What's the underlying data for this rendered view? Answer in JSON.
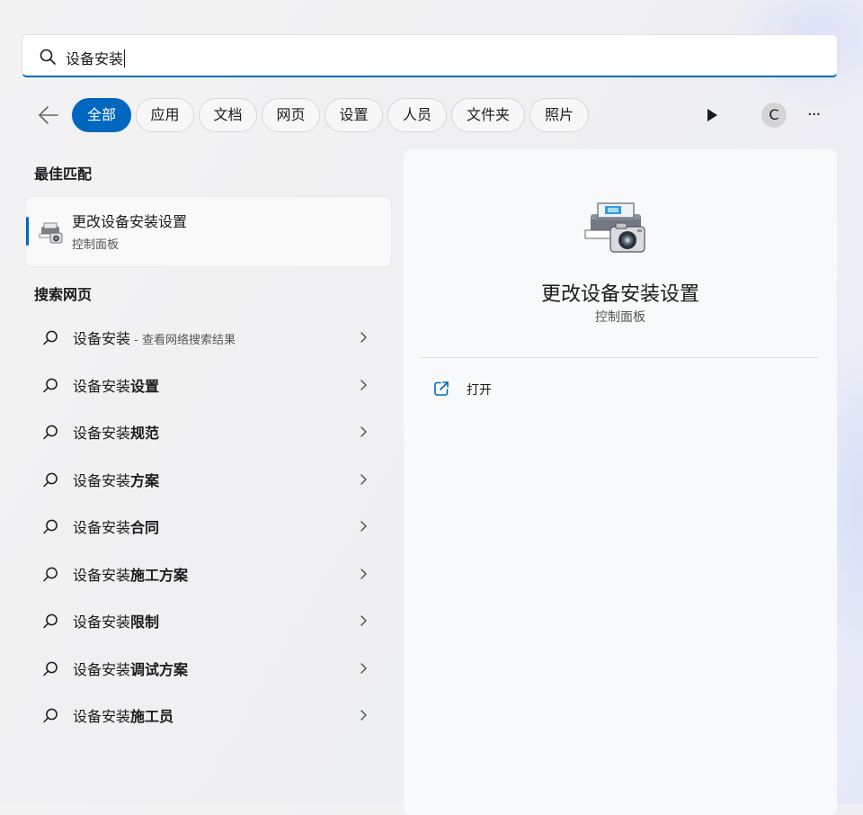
{
  "search": {
    "query": "设备安装"
  },
  "filters": [
    {
      "label": "全部",
      "active": true
    },
    {
      "label": "应用"
    },
    {
      "label": "文档"
    },
    {
      "label": "网页"
    },
    {
      "label": "设置"
    },
    {
      "label": "人员"
    },
    {
      "label": "文件夹"
    },
    {
      "label": "照片"
    }
  ],
  "toolbar": {
    "avatar_initial": "C",
    "more_label": "···"
  },
  "best_match": {
    "heading": "最佳匹配",
    "title": "更改设备安装设置",
    "subtitle": "控制面板"
  },
  "web_search": {
    "heading": "搜索网页",
    "items": [
      {
        "prefix": "设备安装",
        "bold": "",
        "suffix": " - 查看网络搜索结果"
      },
      {
        "prefix": "设备安装",
        "bold": "设置",
        "suffix": ""
      },
      {
        "prefix": "设备安装",
        "bold": "规范",
        "suffix": ""
      },
      {
        "prefix": "设备安装",
        "bold": "方案",
        "suffix": ""
      },
      {
        "prefix": "设备安装",
        "bold": "合同",
        "suffix": ""
      },
      {
        "prefix": "设备安装",
        "bold": "施工方案",
        "suffix": ""
      },
      {
        "prefix": "设备安装",
        "bold": "限制",
        "suffix": ""
      },
      {
        "prefix": "设备安装",
        "bold": "调试方案",
        "suffix": ""
      },
      {
        "prefix": "设备安装",
        "bold": "施工员",
        "suffix": ""
      }
    ]
  },
  "detail": {
    "title": "更改设备安装设置",
    "subtitle": "控制面板",
    "actions": [
      {
        "label": "打开",
        "icon": "open-external-icon"
      }
    ]
  },
  "colors": {
    "accent": "#0067c0"
  }
}
